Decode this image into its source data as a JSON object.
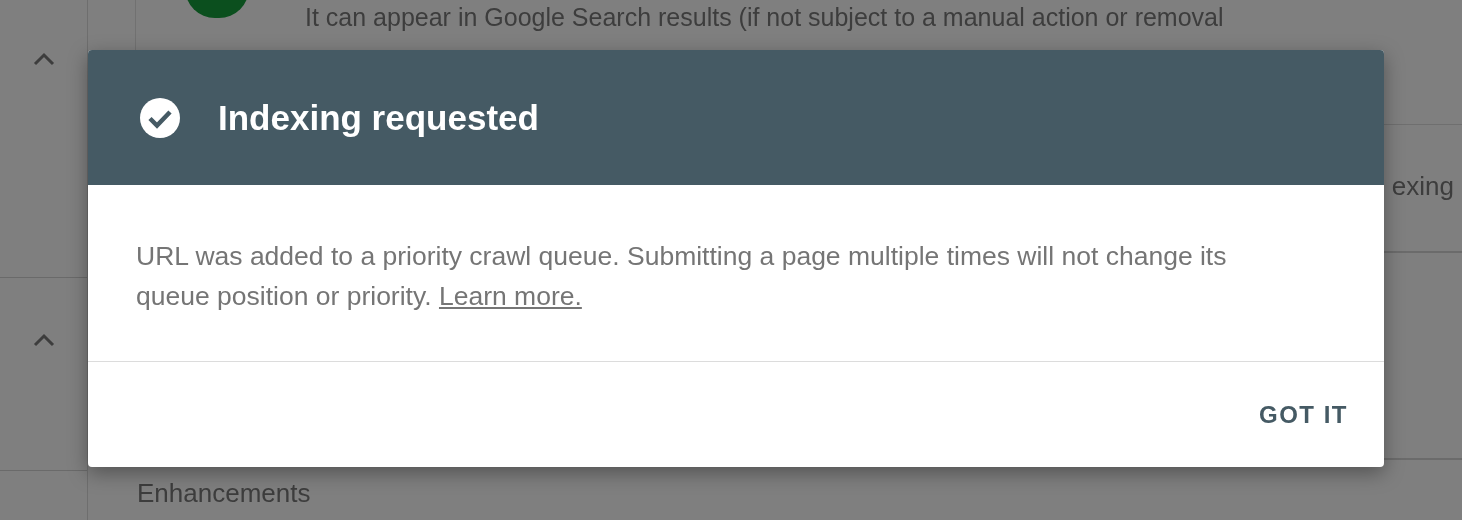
{
  "background": {
    "coverage_text": "It can appear in Google Search results (if not subject to a manual action or removal",
    "status_text": "exing",
    "section_title": "Enhancements"
  },
  "dialog": {
    "title": "Indexing requested",
    "body": "URL was added to a priority crawl queue. Submitting a page multiple times will not change its queue position or priority.",
    "link": "Learn more.",
    "button": "GOT IT"
  }
}
